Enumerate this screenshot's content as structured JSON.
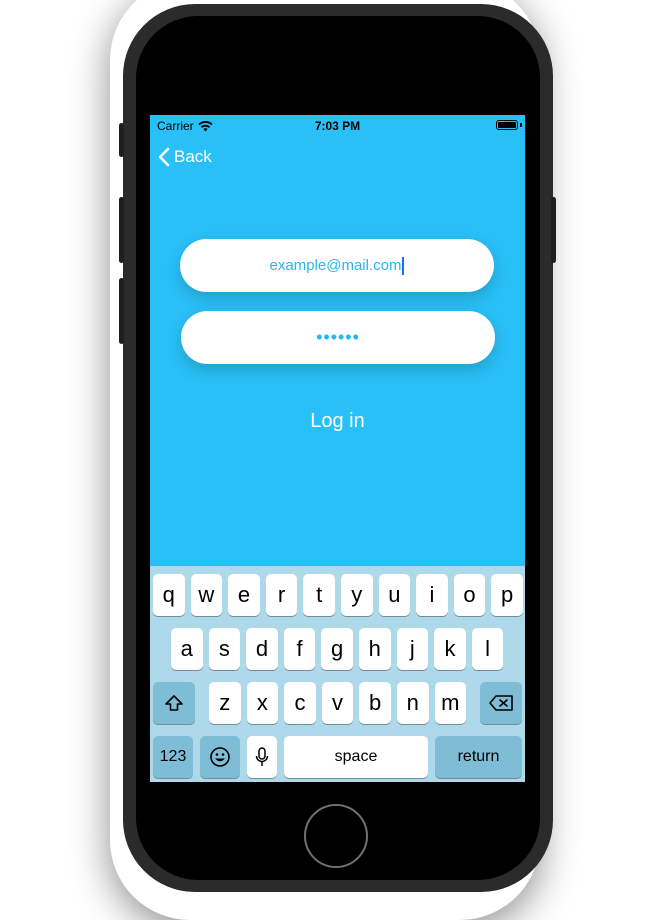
{
  "status_bar": {
    "carrier": "Carrier",
    "time": "7:03 PM"
  },
  "nav": {
    "back_label": "Back"
  },
  "form": {
    "email_value": "example@mail.com",
    "password_mask": "••••••",
    "login_label": "Log in"
  },
  "keyboard": {
    "row1": [
      "q",
      "w",
      "e",
      "r",
      "t",
      "y",
      "u",
      "i",
      "o",
      "p"
    ],
    "row2": [
      "a",
      "s",
      "d",
      "f",
      "g",
      "h",
      "j",
      "k",
      "l"
    ],
    "row3": [
      "z",
      "x",
      "c",
      "v",
      "b",
      "n",
      "m"
    ],
    "numbers_label": "123",
    "space_label": "space",
    "return_label": "return"
  },
  "colors": {
    "screen_bg": "#29c0f7",
    "field_text": "#29b6f0",
    "keyboard_bg": "#aed9ea"
  },
  "icons": [
    "wifi-icon",
    "battery-icon",
    "chevron-left-icon",
    "shift-icon",
    "delete-icon",
    "emoji-icon",
    "microphone-icon"
  ]
}
